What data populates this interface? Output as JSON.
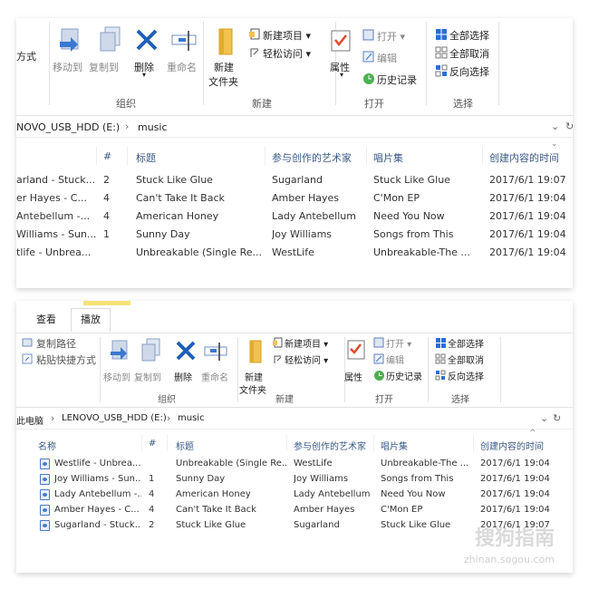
{
  "panel1": {
    "ribbon": {
      "method_label": "方式",
      "move_to": "移动到",
      "copy_to": "复制到",
      "delete": "删除",
      "rename": "重命名",
      "new_folder_line1": "新建",
      "new_folder_line2": "文件夹",
      "new_item": "新建项目 ▾",
      "easy_access": "轻松访问 ▾",
      "properties": "属性",
      "open": "打开 ▾",
      "edit": "编辑",
      "history": "历史记录",
      "select_all": "全部选择",
      "select_none": "全部取消",
      "invert_selection": "反向选择",
      "group_organize": "组织",
      "group_new": "新建",
      "group_open": "打开",
      "group_select": "选择"
    },
    "address": {
      "drive": "NOVO_USB_HDD (E:)",
      "folder": "music"
    },
    "headers": {
      "number": "#",
      "title": "标题",
      "artist": "参与创作的艺术家",
      "album": "唱片集",
      "created": "创建内容的时间"
    },
    "rows": [
      {
        "name": "arland - Stuck...",
        "number": "2",
        "title": "Stuck Like Glue",
        "artist": "Sugarland",
        "album": "Stuck Like Glue",
        "created": "2017/6/1 19:07"
      },
      {
        "name": "er Hayes - C...",
        "number": "4",
        "title": "Can't Take It Back",
        "artist": "Amber Hayes",
        "album": "C'Mon EP",
        "created": "2017/6/1 19:04"
      },
      {
        "name": "Antebellum -...",
        "number": "4",
        "title": "American Honey",
        "artist": "Lady Antebellum",
        "album": "Need You Now",
        "created": "2017/6/1 19:04"
      },
      {
        "name": "Williams - Sun...",
        "number": "1",
        "title": "Sunny Day",
        "artist": "Joy Williams",
        "album": "Songs from This",
        "created": "2017/6/1 19:04"
      },
      {
        "name": "tlife - Unbrea...",
        "number": "",
        "title": "Unbreakable (Single Re...",
        "artist": "WestLife",
        "album": "Unbreakable-The ...",
        "created": "2017/6/1 19:04"
      }
    ]
  },
  "panel2": {
    "tabs": {
      "view": "查看",
      "play": "播放"
    },
    "ribbon": {
      "copy_path": "复制路径",
      "paste_shortcut": "粘贴快捷方式",
      "move_to": "移动到",
      "copy_to": "复制到",
      "delete": "删除",
      "rename": "重命名",
      "new_folder_line1": "新建",
      "new_folder_line2": "文件夹",
      "new_item": "新建项目 ▾",
      "easy_access": "轻松访问 ▾",
      "properties": "属性",
      "open": "打开 ▾",
      "edit": "编辑",
      "history": "历史记录",
      "select_all": "全部选择",
      "select_none": "全部取消",
      "invert_selection": "反向选择",
      "group_organize": "组织",
      "group_new": "新建",
      "group_open": "打开",
      "group_select": "选择"
    },
    "address": {
      "this_pc": "此电脑",
      "drive": "LENOVO_USB_HDD (E:)",
      "folder": "music"
    },
    "headers": {
      "name": "名称",
      "number": "#",
      "title": "标题",
      "artist": "参与创作的艺术家",
      "album": "唱片集",
      "created": "创建内容的时间"
    },
    "rows": [
      {
        "name": "Westlife - Unbrea...",
        "number": "",
        "title": "Unbreakable (Single Re...",
        "artist": "WestLife",
        "album": "Unbreakable-The ...",
        "created": "2017/6/1 19:04"
      },
      {
        "name": "Joy Williams - Sun...",
        "number": "1",
        "title": "Sunny Day",
        "artist": "Joy Williams",
        "album": "Songs from This",
        "created": "2017/6/1 19:04"
      },
      {
        "name": "Lady Antebellum -...",
        "number": "4",
        "title": "American Honey",
        "artist": "Lady Antebellum",
        "album": "Need You Now",
        "created": "2017/6/1 19:04"
      },
      {
        "name": "Amber Hayes - C...",
        "number": "4",
        "title": "Can't Take It Back",
        "artist": "Amber Hayes",
        "album": "C'Mon EP",
        "created": "2017/6/1 19:04"
      },
      {
        "name": "Sugarland - Stuck...",
        "number": "2",
        "title": "Stuck Like Glue",
        "artist": "Sugarland",
        "album": "Stuck Like Glue",
        "created": "2017/6/1 19:07"
      }
    ]
  },
  "watermark": {
    "brand": "搜狗指南",
    "url": "zhinan.sogou.com"
  },
  "colors": {
    "header_text": "#3b5a85",
    "accent_blue": "#2a6fd6",
    "folder_yellow": "#f2c14e",
    "delete_blue": "#1f5fb8"
  }
}
